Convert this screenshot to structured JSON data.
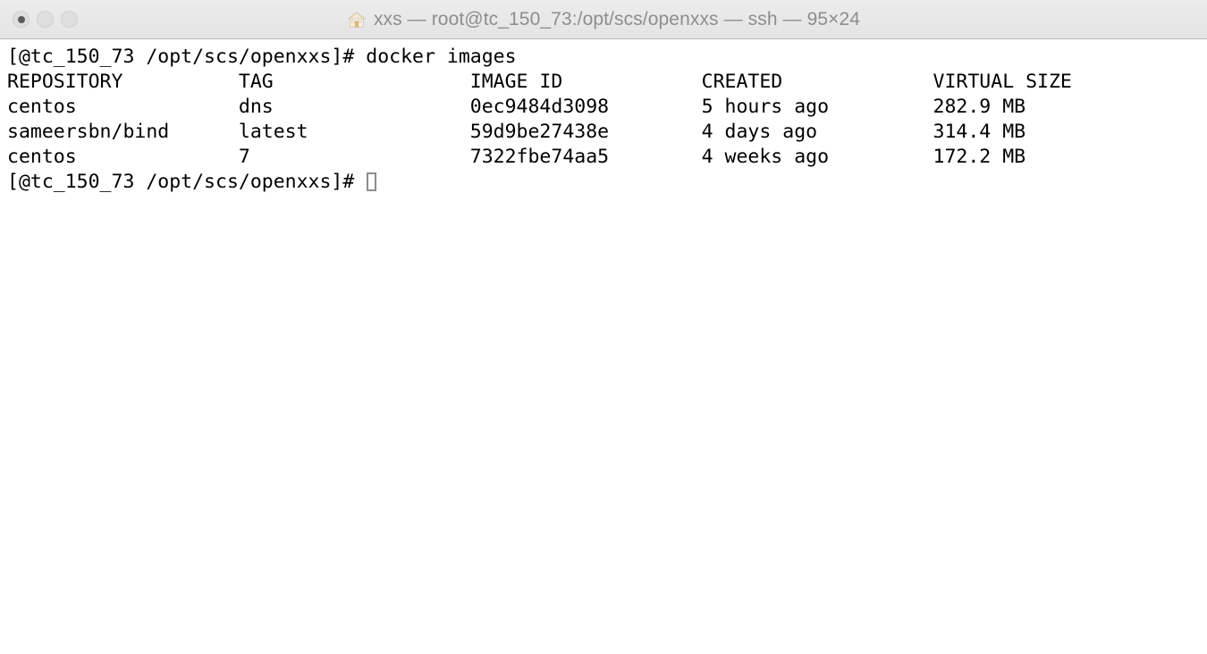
{
  "window": {
    "title": "xxs — root@tc_150_73:/opt/scs/openxxs — ssh — 95×24",
    "app_icon": "home-icon",
    "traffic_lights": [
      {
        "name": "close-button",
        "label": "close",
        "state": "inactive-with-dot"
      },
      {
        "name": "minimize-button",
        "label": "minimize",
        "state": "inactive"
      },
      {
        "name": "maximize-button",
        "label": "maximize",
        "state": "inactive"
      }
    ],
    "size_label": "95×24",
    "colors": {
      "titlebar_bg": "#ececec",
      "titlebar_border": "#b9b9b9",
      "title_text": "#8e8e8e",
      "terminal_bg": "#ffffff",
      "terminal_fg": "#000000",
      "cursor_outline": "#8c8c8c"
    }
  },
  "terminal": {
    "prompt": "[@tc_150_73 /opt/scs/openxxs]# ",
    "command": "docker images",
    "lines": [
      "[@tc_150_73 /opt/scs/openxxs]# docker images",
      "REPOSITORY          TAG                 IMAGE ID            CREATED             VIRTUAL SIZE",
      "centos              dns                 0ec9484d3098        5 hours ago         282.9 MB",
      "sameersbn/bind      latest              59d9be27438e        4 days ago          314.4 MB",
      "centos              7                   7322fbe74aa5        4 weeks ago         172.2 MB"
    ],
    "last_prompt": "[@tc_150_73 /opt/scs/openxxs]# ",
    "cursor": {
      "visible": true,
      "style": "hollow-block",
      "column": 31
    },
    "table": {
      "headers": [
        "REPOSITORY",
        "TAG",
        "IMAGE ID",
        "CREATED",
        "VIRTUAL SIZE"
      ],
      "rows": [
        {
          "repository": "centos",
          "tag": "dns",
          "image_id": "0ec9484d3098",
          "created": "5 hours ago",
          "virtual_size": "282.9 MB"
        },
        {
          "repository": "sameersbn/bind",
          "tag": "latest",
          "image_id": "59d9be27438e",
          "created": "4 days ago",
          "virtual_size": "314.4 MB"
        },
        {
          "repository": "centos",
          "tag": "7",
          "image_id": "7322fbe74aa5",
          "created": "4 weeks ago",
          "virtual_size": "172.2 MB"
        }
      ]
    }
  }
}
